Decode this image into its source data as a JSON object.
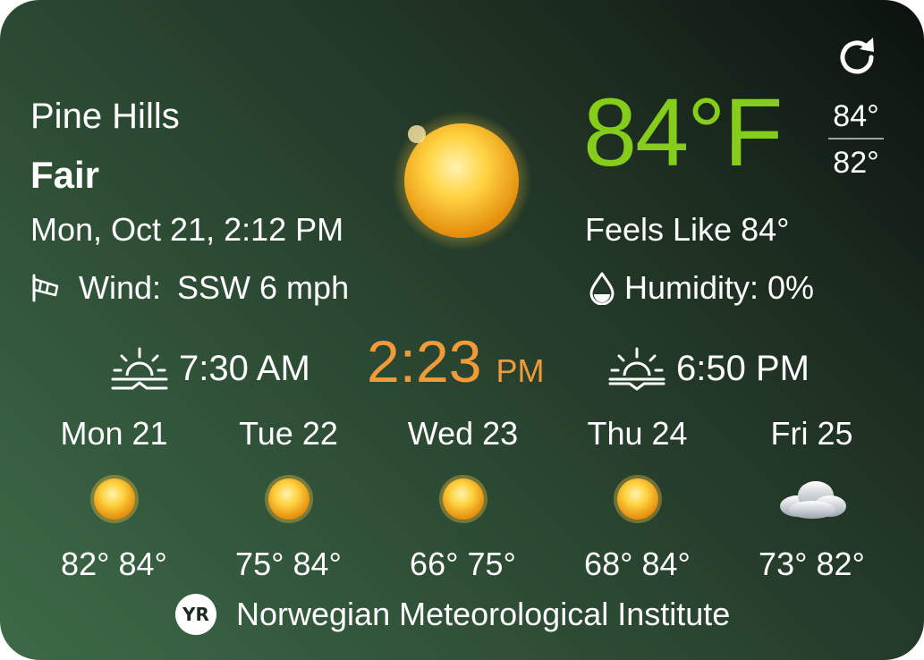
{
  "location": "Pine Hills",
  "condition": "Fair",
  "datetime": "Mon, Oct 21, 2:12 PM",
  "wind": {
    "label": "Wind:",
    "value": "SSW 6 mph",
    "icon": "windsock-icon"
  },
  "temperature": {
    "current": "84°F",
    "high": "84°",
    "low": "82°",
    "color": "#86cc1a"
  },
  "feels_like": "Feels Like 84°",
  "humidity": {
    "text": "Humidity: 0%",
    "icon": "water-drop-icon"
  },
  "sunrise": {
    "time": "7:30 AM",
    "icon": "sunrise-icon"
  },
  "sunset": {
    "time": "6:50 PM",
    "icon": "sunset-icon"
  },
  "clock": {
    "time": "2:23",
    "ampm": "PM",
    "color": "#f19a3a"
  },
  "forecast": [
    {
      "day": "Mon 21",
      "temps": "82° 84°",
      "icon": "sun-icon"
    },
    {
      "day": "Tue 22",
      "temps": "75° 84°",
      "icon": "sun-icon"
    },
    {
      "day": "Wed 23",
      "temps": "66° 75°",
      "icon": "sun-icon"
    },
    {
      "day": "Thu 24",
      "temps": "68° 84°",
      "icon": "sun-icon"
    },
    {
      "day": "Fri 25",
      "temps": "73° 82°",
      "icon": "cloud-icon"
    }
  ],
  "footer": {
    "logo": "YR",
    "provider": "Norwegian Meteorological Institute"
  },
  "refresh_icon": "refresh-icon"
}
